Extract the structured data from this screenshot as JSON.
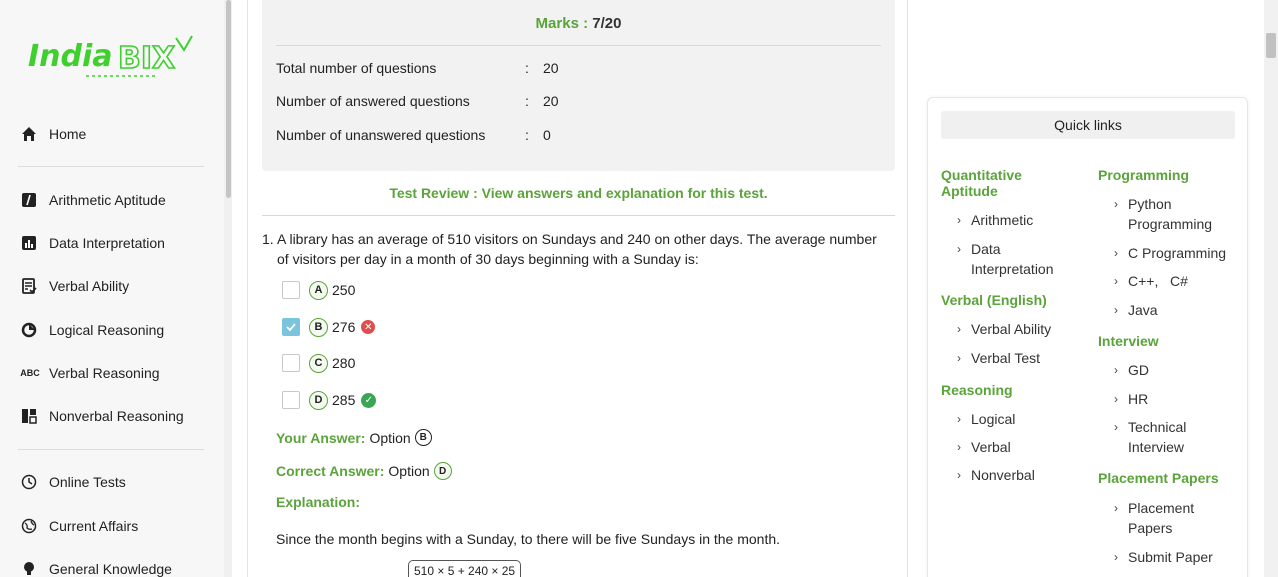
{
  "brand": {
    "logo_text_1": "India",
    "logo_text_2": "BIX"
  },
  "sidebar": {
    "items": [
      {
        "label": "Home",
        "icon": "home-icon"
      },
      {
        "label": "Arithmetic Aptitude",
        "icon": "arithmetic-icon"
      },
      {
        "label": "Data Interpretation",
        "icon": "bar-chart-icon"
      },
      {
        "label": "Verbal Ability",
        "icon": "verbal-icon"
      },
      {
        "label": "Logical Reasoning",
        "icon": "logical-icon"
      },
      {
        "label": "Verbal Reasoning",
        "icon": "abc-icon"
      },
      {
        "label": "Nonverbal Reasoning",
        "icon": "nonverbal-icon"
      },
      {
        "label": "Online Tests",
        "icon": "clock-icon"
      },
      {
        "label": "Current Affairs",
        "icon": "globe-icon"
      },
      {
        "label": "General Knowledge",
        "icon": "bulb-icon"
      }
    ],
    "abc_glyph": "ABC"
  },
  "marks": {
    "label": "Marks :",
    "value": "7/20",
    "stats": [
      {
        "label": "Total number of questions",
        "sep": ":",
        "value": "20"
      },
      {
        "label": "Number of answered questions",
        "sep": ":",
        "value": "20"
      },
      {
        "label": "Number of unanswered questions",
        "sep": ":",
        "value": "0"
      }
    ]
  },
  "review": {
    "text": "Test Review : View answers and explanation for this test."
  },
  "question": {
    "number": "1.",
    "text": "A library has an average of 510 visitors on Sundays and 240 on other days. The average number of visitors per day in a month of 30 days beginning with a Sunday is:",
    "options": [
      {
        "letter": "A",
        "value": "250",
        "checked": false,
        "mark": ""
      },
      {
        "letter": "B",
        "value": "276",
        "checked": true,
        "mark": "wrong"
      },
      {
        "letter": "C",
        "value": "280",
        "checked": false,
        "mark": ""
      },
      {
        "letter": "D",
        "value": "285",
        "checked": false,
        "mark": "correct"
      }
    ],
    "your_answer_label": "Your Answer:",
    "your_answer_text": "Option",
    "your_answer_letter": "B",
    "correct_answer_label": "Correct Answer:",
    "correct_answer_text": "Option",
    "correct_answer_letter": "D",
    "explanation_label": "Explanation:",
    "explanation_text": "Since the month begins with a Sunday, to there will be five Sundays in the month.",
    "formula": "510 × 5 + 240 × 25"
  },
  "quick_links": {
    "title": "Quick links",
    "left": [
      {
        "category": "Quantitative Aptitude",
        "links": [
          "Arithmetic",
          "Data Interpretation"
        ]
      },
      {
        "category": "Verbal (English)",
        "links": [
          "Verbal Ability",
          "Verbal Test"
        ]
      },
      {
        "category": "Reasoning",
        "links": [
          "Logical",
          "Verbal",
          "Nonverbal"
        ]
      }
    ],
    "right": [
      {
        "category": "Programming",
        "links": [
          "Python Programming",
          "C Programming",
          "C++,   C#",
          "Java"
        ]
      },
      {
        "category": "Interview",
        "links": [
          "GD",
          "HR",
          "Technical Interview"
        ]
      },
      {
        "category": "Placement Papers",
        "links": [
          "Placement Papers",
          "Submit Paper"
        ]
      }
    ]
  },
  "colors": {
    "accent": "#5ba33b",
    "wrong": "#e04d4d",
    "correct": "#3aa655",
    "checkbox": "#7cc3dd"
  }
}
